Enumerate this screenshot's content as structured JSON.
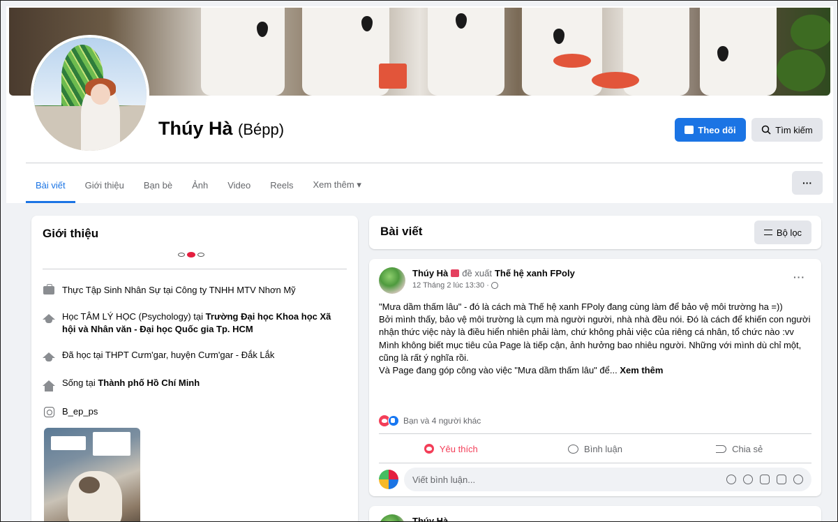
{
  "profile": {
    "name": "Thúy Hà",
    "nickname": "(Bépp)",
    "follow_label": "Theo dõi",
    "search_label": "Tìm kiếm",
    "more_label": "···"
  },
  "tabs": [
    {
      "label": "Bài viết",
      "active": true
    },
    {
      "label": "Giới thiệu"
    },
    {
      "label": "Bạn bè"
    },
    {
      "label": "Ảnh"
    },
    {
      "label": "Video"
    },
    {
      "label": "Reels"
    },
    {
      "label": "Xem thêm ▾"
    }
  ],
  "intro": {
    "title": "Giới thiệu",
    "work": "Thực Tập Sinh Nhân Sự tại Công ty TNHH MTV Nhơn Mỹ",
    "study_prefix": "Học TÂM LÝ HỌC (Psychology) tại ",
    "study_school": "Trường Đại học Khoa học Xã hội và Nhân văn - Đại học Quốc gia Tp. HCM",
    "highschool": "Đã học tại THPT Cưm'gar, huyện Cưm'gar - Đắk Lắk",
    "live_prefix": "Sống tại ",
    "live_city": "Thành phố Hồ Chí Minh",
    "instagram": "B_ep_ps"
  },
  "posts_header": {
    "title": "Bài viết",
    "filter_label": "Bộ lọc"
  },
  "post": {
    "author": "Thúy Hà",
    "verb": "đề xuất",
    "page": "Thế hệ xanh FPoly",
    "time": "12 Tháng 2 lúc 13:30 ·",
    "more": "···",
    "lines": [
      "\"Mưa dầm thấm lâu\" - đó là cách mà Thế hệ xanh FPoly đang cùng làm để bảo vệ môi trường ha =))",
      "Bởi mình thấy, bảo vệ môi trường là cụm mà người người, nhà nhà đều nói. Đó là cách để khiến con người nhận thức việc này là điều hiển nhiên phải làm, chứ không phải việc của riêng cá nhân, tổ chức nào :vv",
      "Mình không biết mục tiêu của Page là tiếp cận, ảnh hưởng bao nhiêu người. Những với mình dù chỉ một, cũng là rất ý nghĩa rồi."
    ],
    "last_line": "Và Page đang góp công vào việc \"Mưa dầm thấm lâu\" để...",
    "see_more": "Xem thêm",
    "reactions_text": "Bạn và 4 người khác",
    "like_label": "Yêu thích",
    "comment_label": "Bình luận",
    "share_label": "Chia sẻ",
    "comment_placeholder": "Viết bình luận..."
  },
  "post2": {
    "author": "Thúy Hà"
  },
  "colors": {
    "accent": "#1b74e4",
    "love": "#f33e58",
    "background": "#f0f2f5"
  }
}
